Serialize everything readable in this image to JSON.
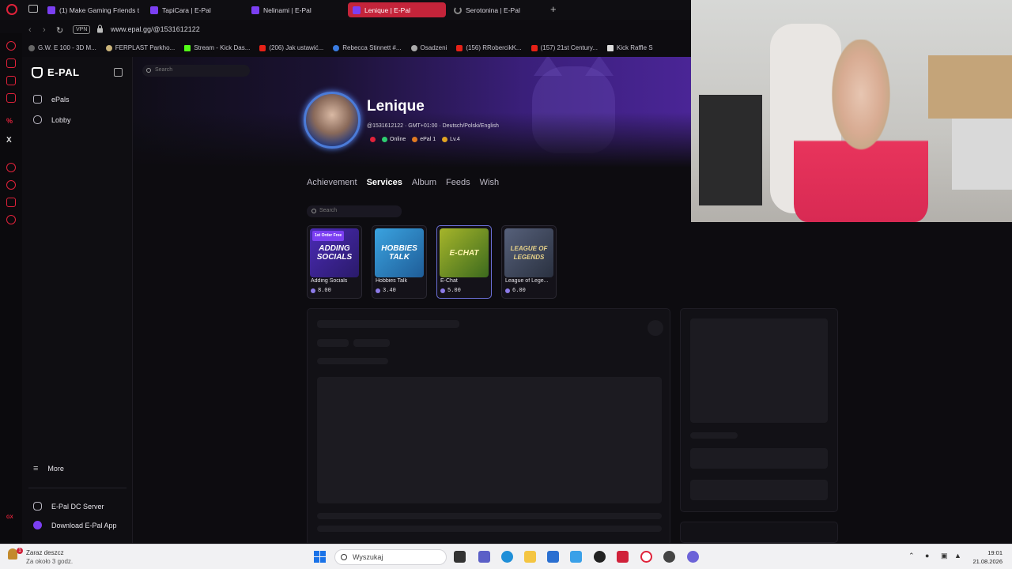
{
  "browser": {
    "tabs": [
      {
        "label": "(1) Make Gaming Friends th",
        "active": false
      },
      {
        "label": "TapiCara | E-Pal",
        "active": false
      },
      {
        "label": "Nelinami | E-Pal",
        "active": false
      },
      {
        "label": "Lenique | E-Pal",
        "active": true
      },
      {
        "label": "Serotonina | E-Pal",
        "active": false
      }
    ],
    "vpn_label": "VPN",
    "url": "www.epal.gg/@1531612122",
    "bookmarks": [
      "G.W. E 100 - 3D M...",
      "FERPLAST Parkho...",
      "Stream - Kick Das...",
      "(206) Jak ustawić...",
      "Rebecca Stinnett #...",
      "Osadzeni",
      "(156) RRobercikK...",
      "(157) 21st Century...",
      "Kick Raffle S"
    ]
  },
  "sidebar": {
    "logo": "E-PAL",
    "items": [
      {
        "label": "ePals",
        "icon": "epal-icon"
      },
      {
        "label": "Lobby",
        "icon": "gamepad-icon"
      }
    ],
    "more_label": "More",
    "bottom_items": [
      {
        "label": "E-Pal DC Server",
        "icon": "discord-icon"
      },
      {
        "label": "Download E-Pal App",
        "icon": "app-icon"
      }
    ]
  },
  "header": {
    "search_placeholder": "Search"
  },
  "profile": {
    "name": "Lenique",
    "meta": "@1531612122 · GMT+01:00 · Deutsch/Polski/English",
    "status": "Online",
    "epal_level": "ePal 1",
    "level": "Lv.4"
  },
  "profile_tabs": [
    {
      "label": "Achievement",
      "active": false
    },
    {
      "label": "Services",
      "active": true
    },
    {
      "label": "Album",
      "active": false
    },
    {
      "label": "Feeds",
      "active": false
    },
    {
      "label": "Wish",
      "active": false
    }
  ],
  "services": {
    "search_placeholder": "Search",
    "cards": [
      {
        "title": "Adding Socials",
        "price": "8.00",
        "thumb_text": "ADDING SOCIALS",
        "badge": "1st Order Free",
        "thumb_color": "#3a2a8f",
        "selected": false
      },
      {
        "title": "Hobbies Talk",
        "price": "3.40",
        "thumb_text": "HOBBIES TALK",
        "badge": "",
        "thumb_color": "#2e86c9",
        "selected": false
      },
      {
        "title": "E-Chat",
        "price": "5.00",
        "thumb_text": "E-CHAT",
        "badge": "",
        "thumb_color": "#3e6a1f",
        "selected": true
      },
      {
        "title": "League of Lege...",
        "price": "6.00",
        "thumb_text": "LEAGUE OF LEGENDS",
        "badge": "",
        "thumb_color": "#3a4456",
        "selected": false
      }
    ]
  },
  "taskbar": {
    "weather_title": "Zaraz deszcz",
    "weather_sub": "Za około 3 godz.",
    "weather_badge": "1",
    "search_placeholder": "Wyszukaj",
    "time": "19:01",
    "date": "21.08.2026"
  },
  "colors": {
    "accent": "#7b3ff2",
    "opera_red": "#e0223a",
    "active_tab": "#c4243a"
  }
}
